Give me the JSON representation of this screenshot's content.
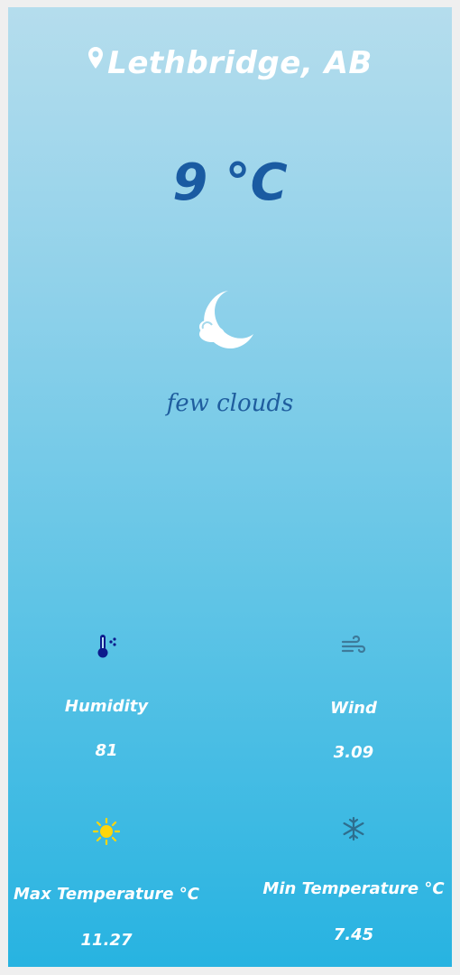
{
  "location": {
    "name": "Lethbridge, AB",
    "icon": "location-pin-icon"
  },
  "current": {
    "temperature": "9 °C",
    "condition": "few clouds",
    "condition_icon": "moon-cloud-icon"
  },
  "stats": {
    "humidity": {
      "label": "Humidity",
      "value": "81",
      "icon": "thermometer-humidity-icon"
    },
    "wind": {
      "label": "Wind",
      "value": "3.09",
      "icon": "wind-icon"
    },
    "max_temp": {
      "label": "Max Temperature °C",
      "value": "11.27",
      "icon": "sun-icon"
    },
    "min_temp": {
      "label": "Min Temperature °C",
      "value": "7.45",
      "icon": "snowflake-icon"
    }
  },
  "colors": {
    "temperature": "#1a5ba2",
    "humidity_icon": "#0d1b8c",
    "sun_icon": "#ffd60a",
    "wind_icon": "#3d7a9a",
    "snowflake_icon": "#2e6e8e"
  }
}
